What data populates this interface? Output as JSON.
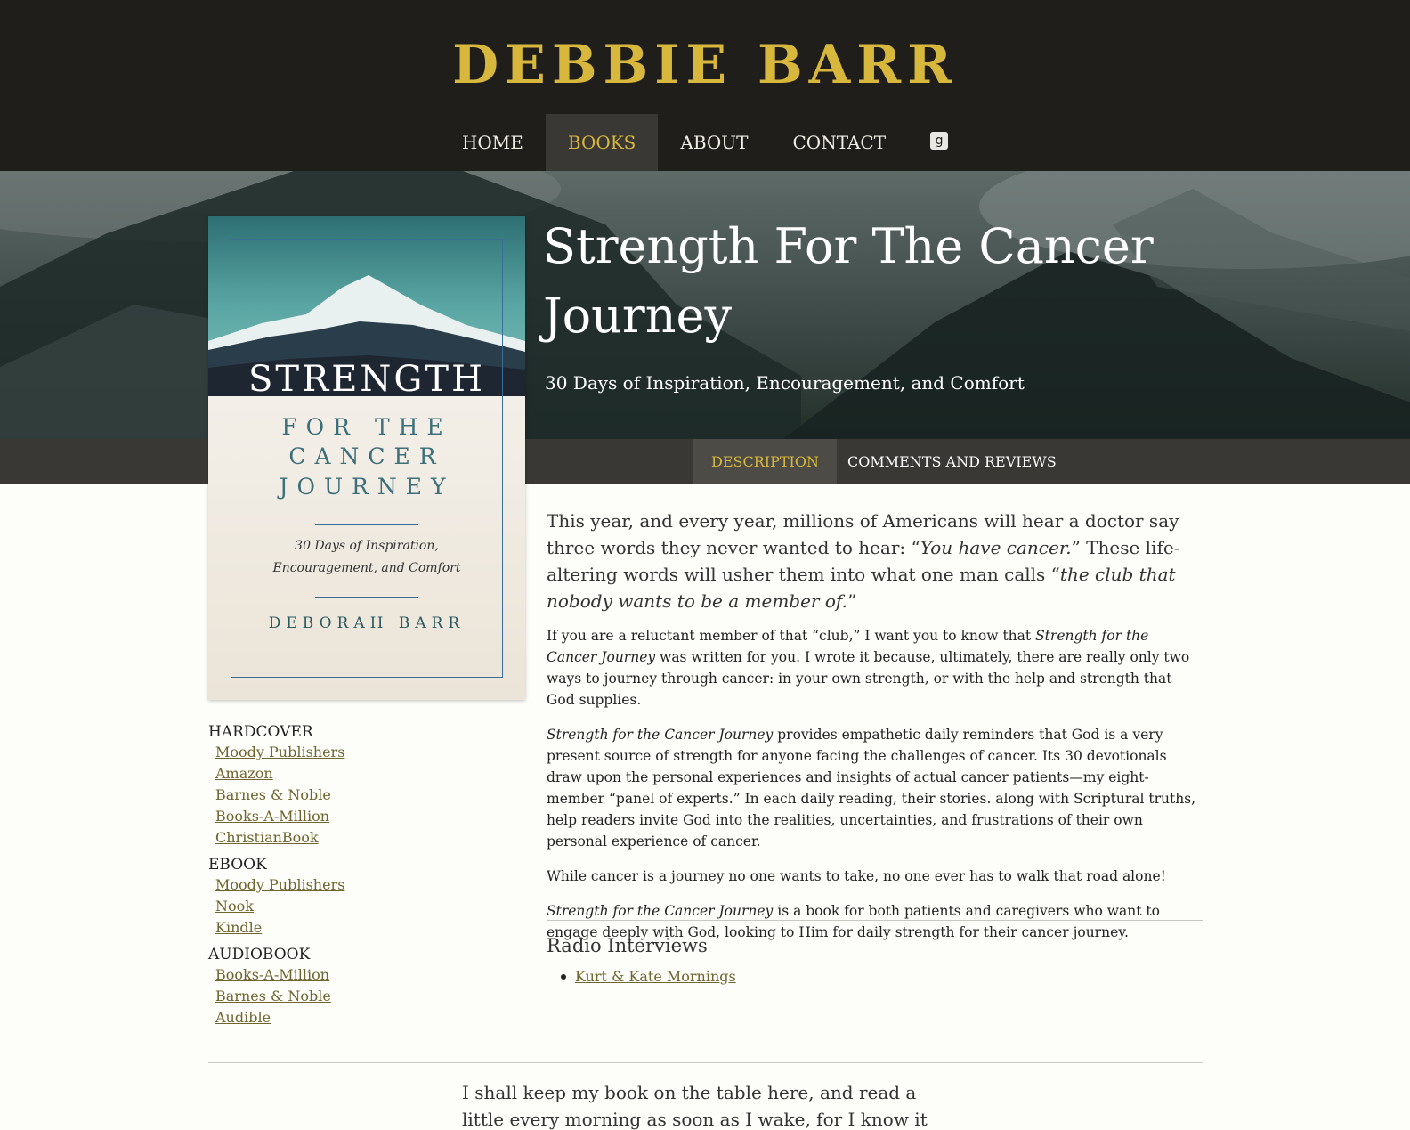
{
  "site": {
    "title": "DEBBIE BARR"
  },
  "nav": {
    "items": [
      {
        "label": "HOME"
      },
      {
        "label": "BOOKS"
      },
      {
        "label": "ABOUT"
      },
      {
        "label": "CONTACT"
      }
    ],
    "icon_glyph": "g",
    "active": "BOOKS"
  },
  "book": {
    "title": "Strength For The Cancer Journey",
    "subtitle": "30 Days of Inspiration, Encouragement, and Comfort"
  },
  "cover": {
    "line1": "STRENGTH",
    "line2": "FOR THE",
    "line3": "CANCER",
    "line4": "JOURNEY",
    "sub1": "30 Days of Inspiration,",
    "sub2": "Encouragement, and Comfort",
    "author": "DEBORAH BARR"
  },
  "tabs": [
    {
      "label": "DESCRIPTION"
    },
    {
      "label": "COMMENTS AND REVIEWS"
    }
  ],
  "buy": {
    "hardcover": {
      "heading": "HARDCOVER",
      "links": [
        "Moody Publishers",
        "Amazon",
        "Barnes & Noble",
        "Books-A-Million",
        "ChristianBook"
      ]
    },
    "ebook": {
      "heading": "EBOOK",
      "links": [
        "Moody Publishers",
        "Nook",
        "Kindle"
      ]
    },
    "audiobook": {
      "heading": "AUDIOBOOK",
      "links": [
        "Books-A-Million",
        "Barnes & Noble",
        "Audible"
      ]
    }
  },
  "description": {
    "lead_1": "This year, and every year, millions of Americans will hear a doctor say three words they never wanted to hear: “",
    "lead_em1": "You have cancer.",
    "lead_2": "” These life-altering words will usher them into what one man calls “",
    "lead_em2": "the club that nobody wants to be a member of.",
    "lead_3": "”",
    "p1_1": "If you are a reluctant member of that “club,” I want you to know that ",
    "p1_em": "Strength for the Cancer Journey",
    "p1_2": " was written for you. I wrote it because, ultimately, there are really only two ways to journey through cancer: in your own strength, or with the help and strength that God supplies.",
    "p2_em": "Strength for the Cancer Journey",
    "p2_2": " provides empathetic daily reminders that God is a very present source of strength for anyone facing the challenges of cancer. Its 30 devotionals draw upon the personal experiences and insights of actual cancer patients—my eight-member “panel of experts.” In each daily reading, their stories. along with Scriptural truths, help readers invite God into the realities, uncertainties, and frustrations of their own personal experience of cancer.",
    "p3": "While cancer is a journey no one wants to take, no one ever has to walk that road alone!",
    "p4_em": "Strength for the Cancer Journey",
    "p4_2": " is a book for both patients and caregivers who want to engage deeply with God, looking to Him for daily strength for their cancer journey."
  },
  "radio": {
    "heading": "Radio Interviews",
    "items": [
      "Kurt & Kate Mornings"
    ]
  },
  "quote": {
    "text": "I shall keep my book on the table here, and read a little every morning as soon as I wake, for I know it will do me"
  }
}
